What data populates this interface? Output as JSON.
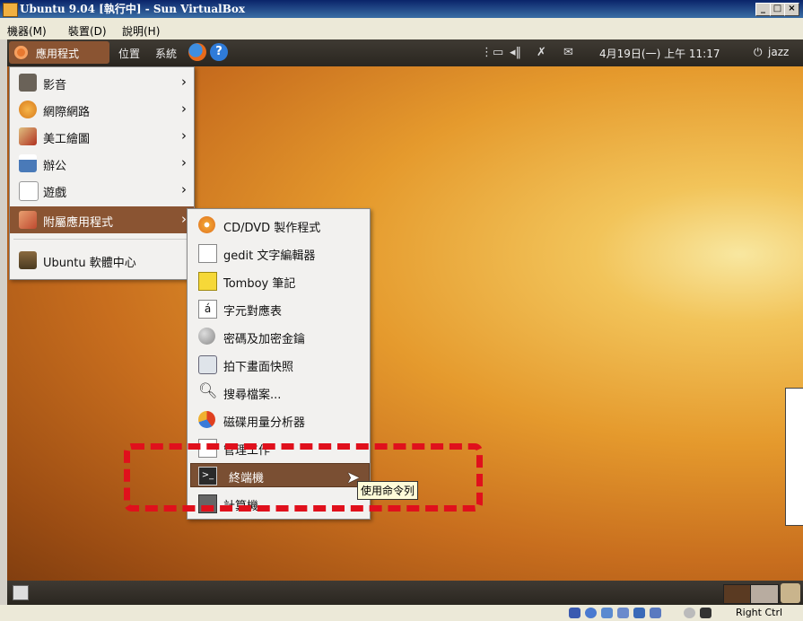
{
  "window": {
    "title": "Ubuntu 9.04 [執行中] - Sun VirtualBox",
    "minimize": "_",
    "maximize": "□",
    "close": "×"
  },
  "vbox_menu": [
    "機器(M)",
    "裝置(D)",
    "說明(H)"
  ],
  "top_panel": {
    "applications": "應用程式",
    "places": "位置",
    "system": "系統",
    "help_glyph": "?",
    "datetime": "4月19日(一) 上午 11:17",
    "user": "jazz"
  },
  "main_menu": [
    {
      "label": "影音",
      "icon": "multimedia-icon",
      "submenu": true
    },
    {
      "label": "網際網路",
      "icon": "internet-icon",
      "submenu": true
    },
    {
      "label": "美工繪圖",
      "icon": "graphics-icon",
      "submenu": true
    },
    {
      "label": "辦公",
      "icon": "office-icon",
      "submenu": true
    },
    {
      "label": "遊戲",
      "icon": "games-icon",
      "submenu": true
    },
    {
      "label": "附屬應用程式",
      "icon": "accessories-icon",
      "submenu": true,
      "active": true
    },
    {
      "label": "Ubuntu 軟體中心",
      "icon": "software-center-icon",
      "submenu": false
    }
  ],
  "submenu": [
    {
      "label": "CD/DVD 製作程式",
      "icon": "disc-burner-icon"
    },
    {
      "label": "gedit 文字編輯器",
      "icon": "text-editor-icon"
    },
    {
      "label": "Tomboy 筆記",
      "icon": "notes-icon"
    },
    {
      "label": "字元對應表",
      "icon": "character-map-icon",
      "glyph": "á"
    },
    {
      "label": "密碼及加密金鑰",
      "icon": "keys-icon"
    },
    {
      "label": "拍下畫面快照",
      "icon": "screenshot-icon"
    },
    {
      "label": "搜尋檔案...",
      "icon": "search-icon"
    },
    {
      "label": "磁碟用量分析器",
      "icon": "disk-usage-icon"
    },
    {
      "label": "管理工作",
      "icon": "tasks-icon"
    },
    {
      "label": "終端機",
      "icon": "terminal-icon",
      "active": true
    },
    {
      "label": "計算機",
      "icon": "calculator-icon"
    }
  ],
  "tooltip": "使用命令列",
  "statusbar": {
    "host_key": "Right Ctrl"
  },
  "colors": {
    "menu_active": "#8a5432",
    "highlight": "#e0101c",
    "panel": "#3a342c"
  }
}
